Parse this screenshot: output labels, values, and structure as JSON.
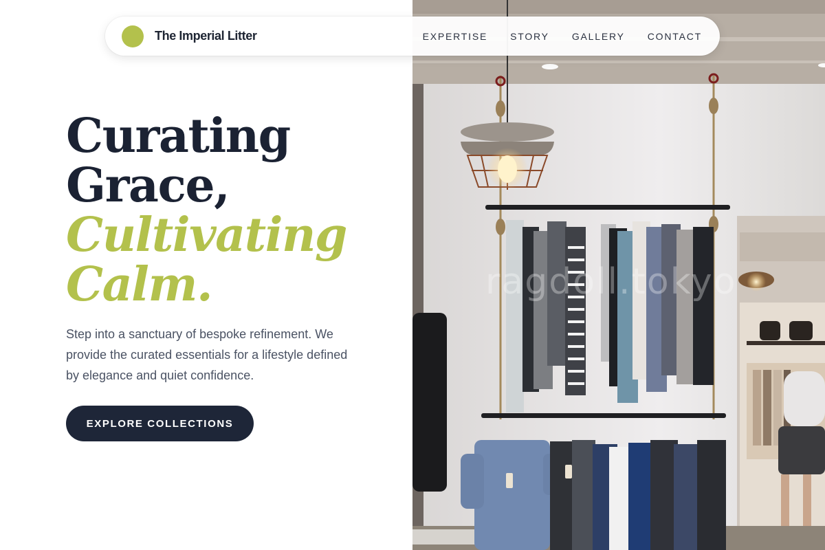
{
  "nav": {
    "brand": "The Imperial Litter",
    "links": [
      "EXPERTISE",
      "STORY",
      "GALLERY",
      "CONTACT"
    ]
  },
  "hero": {
    "title_line1": "Curating",
    "title_line2": "Grace,",
    "title_accent1": "Cultivating",
    "title_accent2": "Calm.",
    "description": "Step into a sanctuary of bespoke refinement. We provide the curated essentials for a lifestyle defined by elegance and quiet confidence.",
    "cta": "EXPLORE COLLECTIONS"
  },
  "photo": {
    "watermark": "ragdoll.tokyo"
  },
  "colors": {
    "accent": "#b3c14c",
    "dark": "#1e2638",
    "text": "#4a5263"
  }
}
